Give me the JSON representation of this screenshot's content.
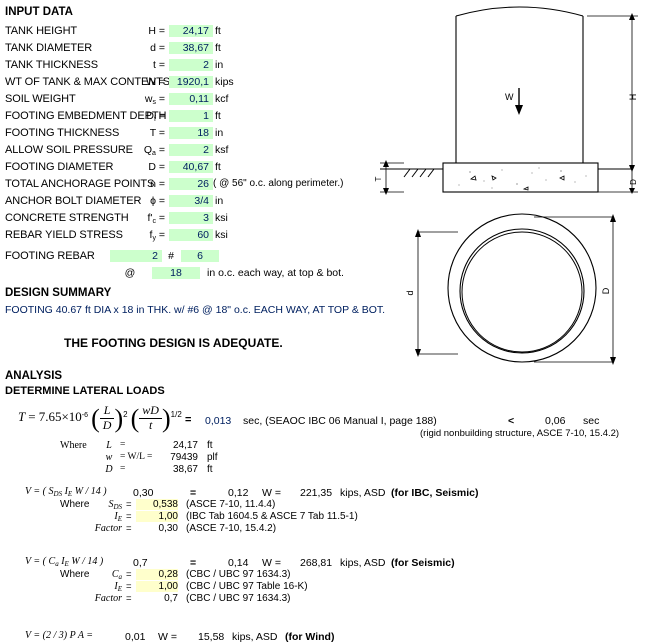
{
  "sections": {
    "input_title": "INPUT DATA",
    "design_summary_title": "DESIGN SUMMARY",
    "analysis_title": "ANALYSIS",
    "lateral_title": "DETERMINE LATERAL  LOADS"
  },
  "input_rows": [
    {
      "label": "TANK HEIGHT",
      "sym": "H",
      "sub": "",
      "value": "24,17",
      "unit": "ft",
      "note": ""
    },
    {
      "label": "TANK DIAMETER",
      "sym": "d",
      "sub": "",
      "value": "38,67",
      "unit": "ft",
      "note": ""
    },
    {
      "label": "TANK THICKNESS",
      "sym": "t",
      "sub": "",
      "value": "2",
      "unit": "in",
      "note": ""
    },
    {
      "label": "WT OF TANK & MAX CONTENTS",
      "sym": "W",
      "sub": "",
      "value": "1920,1",
      "unit": "kips",
      "note": ""
    },
    {
      "label": "SOIL WEIGHT",
      "sym": "w",
      "sub": "s",
      "value": "0,11",
      "unit": "kcf",
      "note": ""
    },
    {
      "label": "FOOTING EMBEDMENT DEPTH",
      "sym": "D",
      "sub": "f",
      "value": "1",
      "unit": "ft",
      "note": ""
    },
    {
      "label": "FOOTING THICKNESS",
      "sym": "T",
      "sub": "",
      "value": "18",
      "unit": "in",
      "note": ""
    },
    {
      "label": "ALLOW SOIL PRESSURE",
      "sym": "Q",
      "sub": "a",
      "value": "2",
      "unit": "ksf",
      "note": ""
    },
    {
      "label": "FOOTING DIAMETER",
      "sym": "D",
      "sub": "",
      "value": "40,67",
      "unit": "ft",
      "note": ""
    },
    {
      "label": "TOTAL ANCHORAGE POINTS",
      "sym": "n",
      "sub": "",
      "value": "26",
      "unit": "",
      "note": "( @ 56\" o.c. along perimeter.)"
    },
    {
      "label": "ANCHOR BOLT DIAMETER",
      "sym": "ϕ",
      "sub": "",
      "value": "3/4",
      "unit": "in",
      "note": ""
    },
    {
      "label": "CONCRETE STRENGTH",
      "sym": "f'",
      "sub": "c",
      "value": "3",
      "unit": "ksi",
      "note": ""
    },
    {
      "label": "REBAR YIELD STRESS",
      "sym": "f",
      "sub": "y",
      "value": "60",
      "unit": "ksi",
      "note": ""
    }
  ],
  "rebar": {
    "label": "FOOTING REBAR",
    "count": "2",
    "hash": "#",
    "size": "6",
    "at": "@",
    "spacing": "18",
    "spacing_note": "in o.c. each way, at top & bot."
  },
  "design_summary": {
    "line": "FOOTING 40.67 ft DIA x 18 in THK. w/  #6 @ 18\" o.c. EACH WAY, AT TOP & BOT.",
    "verdict": "THE FOOTING DESIGN IS ADEQUATE."
  },
  "period": {
    "coef": "7.65×10",
    "exp": "-6",
    "lhs": "T",
    "eq": "=",
    "num1": "L",
    "den1": "D",
    "pow1": "2",
    "num2": "wD",
    "den2": "t",
    "pow2": "1/2",
    "result": "0,013",
    "result_unit": "sec, (SEAOC IBC 06 Manual I, page 188)",
    "compare_op": "<",
    "limit": "0,06",
    "limit_unit": "sec",
    "limit_note": "(rigid nonbuilding structure, ASCE 7-10, 15.4.2)",
    "where": "Where",
    "terms": [
      {
        "sym": "L",
        "sub": "",
        "eq": "=",
        "value": "24,17",
        "unit": "ft"
      },
      {
        "sym": "w",
        "sub": "",
        "eq": "= W/L =",
        "value": "79439",
        "unit": "plf"
      },
      {
        "sym": "D",
        "sub": "",
        "eq": "=",
        "value": "38,67",
        "unit": "ft"
      }
    ]
  },
  "shear_blocks": [
    {
      "formula": "V = ( S",
      "formula_sub1": "DS",
      "formula_mid": " I",
      "formula_sub2": "E",
      "formula_end": " W / 14 )",
      "factor": "0,30",
      "eq": "=",
      "coef": "0,12",
      "w_label": "W =",
      "force": "221,35",
      "force_unit": "kips, ASD",
      "tag": "(for IBC, Seismic)",
      "where": "Where",
      "terms": [
        {
          "sym": "S",
          "sub": "DS",
          "eq": "=",
          "value": "0,538",
          "hl": "yellow",
          "ref": "(ASCE 7-10, 11.4.4)"
        },
        {
          "sym": "I",
          "sub": "E",
          "eq": "=",
          "value": "1,00",
          "hl": "yellow",
          "ref": "(IBC Tab 1604.5 & ASCE 7 Tab 11.5-1)"
        },
        {
          "sym": "Factor",
          "sub": "",
          "eq": "=",
          "value": "0,30",
          "hl": "none",
          "ref": "(ASCE 7-10, 15.4.2)"
        }
      ]
    },
    {
      "formula": "V = ( C",
      "formula_sub1": "a",
      "formula_mid": " I",
      "formula_sub2": "E",
      "formula_end": " W / 14 )",
      "factor": "0,7",
      "eq": "=",
      "coef": "0,14",
      "w_label": "W =",
      "force": "268,81",
      "force_unit": "kips, ASD",
      "tag": "(for Seismic)",
      "where": "Where",
      "terms": [
        {
          "sym": "C",
          "sub": "a",
          "eq": "=",
          "value": "0,28",
          "hl": "yellow",
          "ref": "(CBC / UBC 97 1634.3)"
        },
        {
          "sym": "I",
          "sub": "E",
          "eq": "=",
          "value": "1,00",
          "hl": "yellow",
          "ref": "(CBC / UBC 97 Table 16-K)"
        },
        {
          "sym": "Factor",
          "sub": "",
          "eq": "=",
          "value": "0,7",
          "hl": "none",
          "ref": "(CBC / UBC 97 1634.3)"
        }
      ]
    }
  ],
  "wind_line": {
    "formula": "V = (2 / 3) P A  =",
    "coef": "0,01",
    "w_label": "W =",
    "force": "15,58",
    "force_unit": "kips, ASD",
    "tag": "(for Wind)"
  },
  "elevation_diagram": {
    "name": "tank-elevation-view",
    "load_label": "W",
    "height_label": "H",
    "thickness_label": "T",
    "embedment_label": "D"
  },
  "plan_diagram": {
    "name": "tank-plan-view",
    "inner_label": "d",
    "outer_label": "D"
  },
  "colors": {
    "input_highlight": "#ccffcc",
    "calc_highlight": "#ffffcc",
    "value_text": "#002060"
  }
}
